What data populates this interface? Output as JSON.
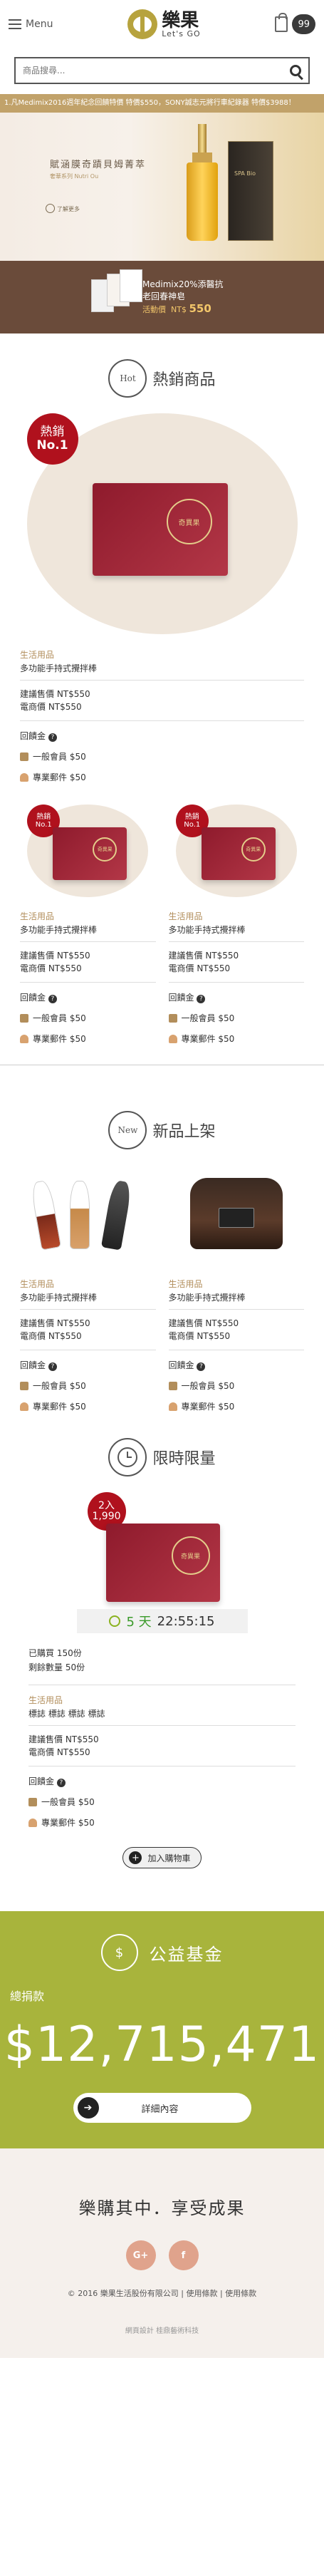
{
  "header": {
    "menu_label": "Menu",
    "logo_zh": "樂果",
    "logo_en": "Let's GO",
    "cart_count": "99"
  },
  "search": {
    "placeholder": "商品搜尋..."
  },
  "marquee": "1.凡Medimix2016週年紀念回饋特價 特價$550，SONY誠志元將行車紀錄器 特價$3988！",
  "banner": {
    "title": "賦涵膜奇蹟貝姆菁萃",
    "subtitle": "奢華系列 Nutri Ou",
    "more": "了解更多",
    "box_label": "SPA Bio"
  },
  "promo": {
    "line1": "Medimix20%添醫抗",
    "line2": "老回春神皂",
    "price_label": "活動價",
    "price_currency": "NT$",
    "price_value": "550"
  },
  "hot": {
    "icon_label": "Hot",
    "title": "熱銷商品",
    "main": {
      "badge_line1": "熱銷",
      "badge_line2": "No.1",
      "seal": "奇異果",
      "category": "生活用品",
      "name": "多功能手持式攪拌棒",
      "suggest_price": "建議售價 NT$550",
      "member_price": "電商價 NT$550",
      "cashback_label": "回饋金",
      "general_label": "一般會員 $50",
      "vip_label": "專業郵件 $50"
    },
    "items": [
      {
        "badge_line1": "熱銷",
        "badge_line2": "No.1",
        "seal": "奇異果",
        "category": "生活用品",
        "name": "多功能手持式攪拌棒",
        "suggest_price": "建議售價 NT$550",
        "member_price": "電商價 NT$550",
        "cashback_label": "回饋金",
        "general_label": "一般會員 $50",
        "vip_label": "專業郵件 $50"
      },
      {
        "badge_line1": "熱銷",
        "badge_line2": "No.1",
        "seal": "奇異果",
        "category": "生活用品",
        "name": "多功能手持式攪拌棒",
        "suggest_price": "建議售價 NT$550",
        "member_price": "電商價 NT$550",
        "cashback_label": "回饋金",
        "general_label": "一般會員 $50",
        "vip_label": "專業郵件 $50"
      }
    ]
  },
  "new": {
    "icon_label": "New",
    "title": "新品上架",
    "items": [
      {
        "category": "生活用品",
        "name": "多功能手持式攪拌棒",
        "suggest_price": "建議售價 NT$550",
        "member_price": "電商價 NT$550",
        "cashback_label": "回饋金",
        "general_label": "一般會員 $50",
        "vip_label": "專業郵件 $50"
      },
      {
        "category": "生活用品",
        "name": "多功能手持式攪拌棒",
        "suggest_price": "建議售價 NT$550",
        "member_price": "電商價 NT$550",
        "cashback_label": "回饋金",
        "general_label": "一般會員 $50",
        "vip_label": "專業郵件 $50"
      }
    ]
  },
  "timed": {
    "title": "限時限量",
    "badge_line1": "2入",
    "badge_line2": "1,990",
    "seal": "奇異果",
    "countdown_days": "5 天",
    "countdown_time": "22:55:15",
    "sold": "已購買 150份",
    "remaining": "剩餘數量 50份",
    "category": "生活用品",
    "name": "標誌 標誌 標誌 標誌",
    "suggest_price": "建議售價 NT$550",
    "member_price": "電商價 NT$550",
    "cashback_label": "回饋金",
    "general_label": "一般會員 $50",
    "vip_label": "專業郵件 $50",
    "add_cart_label": "加入購物車"
  },
  "charity": {
    "title": "公益基金",
    "donated_label": "總捐款",
    "total": "$12,715,471",
    "detail_label": "詳細內容"
  },
  "footer": {
    "slogan": "樂購其中．享受成果",
    "social_google": "G+",
    "social_facebook": "f",
    "copyright": "© 2016 樂果生活股份有限公司 | 使用條款 | 使用條款",
    "credit": "網頁設計 桂鼎藝術科技"
  },
  "colors": {
    "accent": "#c1a26a",
    "badge_red": "#b0111d",
    "charity_green": "#a8b43c",
    "promo_brown": "#6a4b3a"
  },
  "icons": {
    "search": "search-icon",
    "cart": "shopping-bag-icon",
    "menu": "hamburger-icon"
  }
}
